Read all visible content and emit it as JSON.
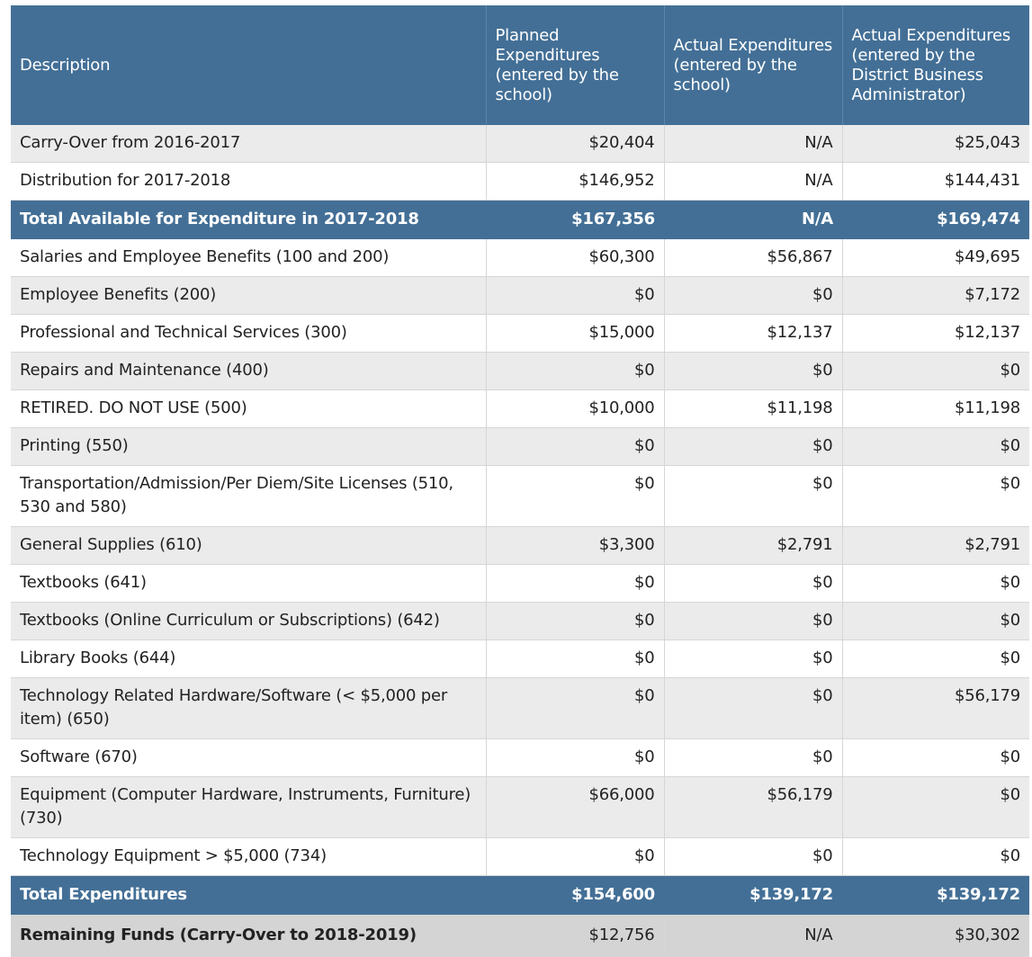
{
  "table": {
    "headers": [
      "Description",
      "Planned Expenditures (entered by the school)",
      "Actual Expenditures (entered by the school)",
      "Actual Expenditures (entered by the District Business Administrator)"
    ],
    "rows": [
      {
        "type": "odd",
        "cells": [
          "Carry-Over from 2016-2017",
          "$20,404",
          "N/A",
          "$25,043"
        ]
      },
      {
        "type": "even",
        "cells": [
          "Distribution for 2017-2018",
          "$146,952",
          "N/A",
          "$144,431"
        ]
      },
      {
        "type": "total",
        "cells": [
          "Total Available for Expenditure in 2017-2018",
          "$167,356",
          "N/A",
          "$169,474"
        ]
      },
      {
        "type": "even",
        "cells": [
          "Salaries and Employee Benefits (100 and 200)",
          "$60,300",
          "$56,867",
          "$49,695"
        ]
      },
      {
        "type": "odd",
        "cells": [
          "Employee Benefits (200)",
          "$0",
          "$0",
          "$7,172"
        ]
      },
      {
        "type": "even",
        "cells": [
          "Professional and Technical Services (300)",
          "$15,000",
          "$12,137",
          "$12,137"
        ]
      },
      {
        "type": "odd",
        "cells": [
          "Repairs and Maintenance (400)",
          "$0",
          "$0",
          "$0"
        ]
      },
      {
        "type": "even",
        "cells": [
          "RETIRED. DO NOT USE (500)",
          "$10,000",
          "$11,198",
          "$11,198"
        ]
      },
      {
        "type": "odd",
        "cells": [
          "Printing (550)",
          "$0",
          "$0",
          "$0"
        ]
      },
      {
        "type": "even",
        "cells": [
          "Transportation/Admission/Per Diem/Site Licenses (510, 530 and 580)",
          "$0",
          "$0",
          "$0"
        ]
      },
      {
        "type": "odd",
        "cells": [
          "General Supplies (610)",
          "$3,300",
          "$2,791",
          "$2,791"
        ]
      },
      {
        "type": "even",
        "cells": [
          "Textbooks (641)",
          "$0",
          "$0",
          "$0"
        ]
      },
      {
        "type": "odd",
        "cells": [
          "Textbooks (Online Curriculum or Subscriptions) (642)",
          "$0",
          "$0",
          "$0"
        ]
      },
      {
        "type": "even",
        "cells": [
          "Library Books (644)",
          "$0",
          "$0",
          "$0"
        ]
      },
      {
        "type": "odd",
        "cells": [
          "Technology Related Hardware/Software (< $5,000 per item) (650)",
          "$0",
          "$0",
          "$56,179"
        ]
      },
      {
        "type": "even",
        "cells": [
          "Software (670)",
          "$0",
          "$0",
          "$0"
        ]
      },
      {
        "type": "odd",
        "cells": [
          "Equipment (Computer Hardware, Instruments, Furniture) (730)",
          "$66,000",
          "$56,179",
          "$0"
        ]
      },
      {
        "type": "even",
        "cells": [
          "Technology Equipment > $5,000 (734)",
          "$0",
          "$0",
          "$0"
        ]
      },
      {
        "type": "total",
        "cells": [
          "Total Expenditures",
          "$154,600",
          "$139,172",
          "$139,172"
        ]
      },
      {
        "type": "remaining",
        "cells": [
          "Remaining Funds (Carry-Over to 2018-2019)",
          "$12,756",
          "N/A",
          "$30,302"
        ]
      }
    ]
  },
  "colors": {
    "header_bg": "#436f96",
    "stripe_bg": "#ebebeb",
    "remaining_bg": "#d4d4d4"
  }
}
